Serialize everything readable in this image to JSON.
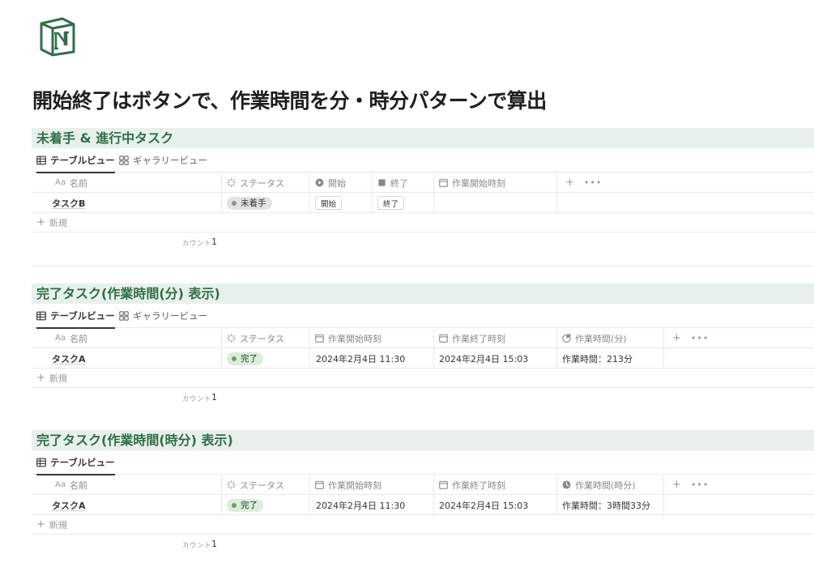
{
  "page_title": "開始終了はボタンで、作業時間を分・時分パターンで算出",
  "accent_color": "#2f6f4a",
  "section_header_bg": "#e8f0ea",
  "sections": [
    {
      "title": "未着手 & 進行中タスク",
      "tabs": {
        "table": "テーブルビュー",
        "gallery": "ギャラリービュー"
      },
      "columns": {
        "name": "名前",
        "status": "ステータス",
        "c3": "開始",
        "c4": "終了",
        "c5": "作業開始時刻"
      },
      "row": {
        "name": "タスクB",
        "status": "未着手",
        "c3": "開始",
        "c4": "終了",
        "c5": ""
      },
      "new_label": "新規",
      "count_label": "カウント",
      "count_value": "1"
    },
    {
      "title": "完了タスク(作業時間(分) 表示)",
      "tabs": {
        "table": "テーブルビュー",
        "gallery": "ギャラリービュー"
      },
      "columns": {
        "name": "名前",
        "status": "ステータス",
        "c3": "作業開始時刻",
        "c4": "作業終了時刻",
        "c5": "作業時間(分)"
      },
      "row": {
        "name": "タスクA",
        "status": "完了",
        "c3": "2024年2月4日 11:30",
        "c4": "2024年2月4日 15:03",
        "c5": "作業時間：213分"
      },
      "new_label": "新規",
      "count_label": "カウント",
      "count_value": "1"
    },
    {
      "title": "完了タスク(作業時間(時分) 表示)",
      "tabs": {
        "table": "テーブルビュー"
      },
      "columns": {
        "name": "名前",
        "status": "ステータス",
        "c3": "作業開始時刻",
        "c4": "作業終了時刻",
        "c5": "作業時間(時分)"
      },
      "row": {
        "name": "タスクA",
        "status": "完了",
        "c3": "2024年2月4日 11:30",
        "c4": "2024年2月4日 15:03",
        "c5": "作業時間：3時間33分"
      },
      "new_label": "新規",
      "count_label": "カウント",
      "count_value": "1"
    }
  ],
  "icons": {
    "logo": "notion-logo",
    "table": "table-icon",
    "gallery": "gallery-icon",
    "status": "status-icon",
    "calendar": "calendar-icon",
    "button": "button-play-icon",
    "stop": "stop-icon",
    "formula": "formula-clock-icon",
    "add": "plus-icon",
    "more": "more-dots-icon"
  },
  "header_symbols": {
    "aa": "Aa",
    "plus": "+",
    "dots": "•••"
  }
}
